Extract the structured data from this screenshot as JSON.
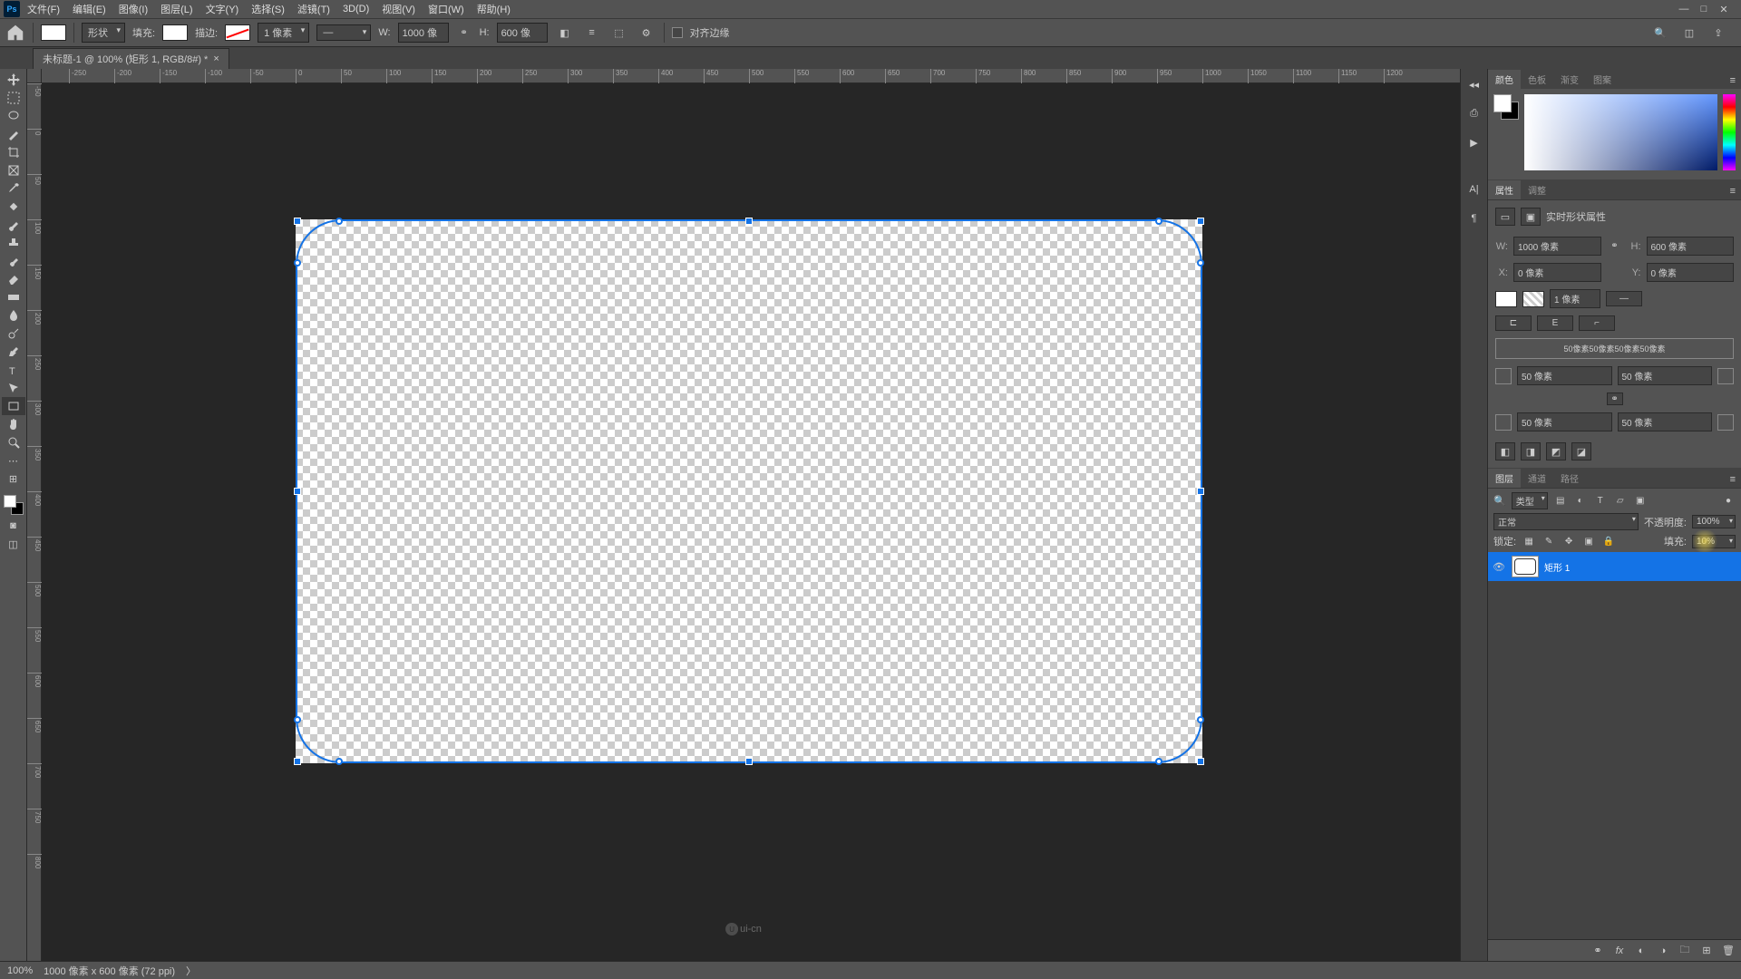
{
  "menu": {
    "file": "文件(F)",
    "edit": "编辑(E)",
    "image": "图像(I)",
    "layer": "图层(L)",
    "type": "文字(Y)",
    "select": "选择(S)",
    "filter": "滤镜(T)",
    "threeD": "3D(D)",
    "view": "视图(V)",
    "window": "窗口(W)",
    "help": "帮助(H)"
  },
  "options": {
    "shape_mode": "形状",
    "fill_label": "填充:",
    "stroke_label": "描边:",
    "stroke_width": "1 像素",
    "w_label": "W:",
    "w_value": "1000 像",
    "link": "⚭",
    "h_label": "H:",
    "h_value": "600 像",
    "align_edges_label": "对齐边缘"
  },
  "doc": {
    "tab_title": "未标题-1 @ 100% (矩形 1, RGB/8#) *"
  },
  "ruler_h": [
    "-250",
    "-200",
    "-150",
    "-100",
    "-50",
    "0",
    "50",
    "100",
    "150",
    "200",
    "250",
    "300",
    "350",
    "400",
    "450",
    "500",
    "550",
    "600",
    "650",
    "700",
    "750",
    "800",
    "850",
    "900",
    "950",
    "1000",
    "1050",
    "1100",
    "1150",
    "1200"
  ],
  "ruler_v": [
    "0",
    "5",
    "1",
    "0",
    "0",
    "1",
    "5",
    "0",
    "2",
    "0",
    "0",
    "2",
    "5",
    "0",
    "3",
    "0",
    "0",
    "3",
    "5",
    "0",
    "4",
    "0",
    "0",
    "4",
    "5",
    "0",
    "5",
    "0",
    "0",
    "5",
    "5",
    "0",
    "6",
    "0",
    "0",
    "6",
    "5",
    "0",
    "7",
    "0",
    "0"
  ],
  "color_tabs": {
    "color": "颜色",
    "swatches": "色板",
    "gradient": "渐变",
    "pattern": "图案"
  },
  "props_tabs": {
    "properties": "属性",
    "adjust": "调整"
  },
  "props": {
    "header": "实时形状属性",
    "W": "W:",
    "W_val": "1000 像素",
    "H": "H:",
    "H_val": "600 像素",
    "X": "X:",
    "X_val": "0 像素",
    "Y": "Y:",
    "Y_val": "0 像素",
    "stroke_width": "1 像素",
    "corner_summary": "50像素50像素50像素50像素",
    "corner_tl": "50 像素",
    "corner_tr": "50 像素",
    "corner_bl": "50 像素",
    "corner_br": "50 像素"
  },
  "layers_tabs": {
    "layers": "图层",
    "channels": "通道",
    "paths": "路径"
  },
  "layers": {
    "kind": "类型",
    "blend": "正常",
    "opacity_label": "不透明度:",
    "opacity": "100%",
    "lock_label": "锁定:",
    "fill_label": "填充:",
    "fill": "10%",
    "layer1": "矩形 1"
  },
  "status": {
    "zoom": "100%",
    "dims": "1000 像素 x 600 像素 (72 ppi)"
  },
  "watermark": "ui-cn"
}
